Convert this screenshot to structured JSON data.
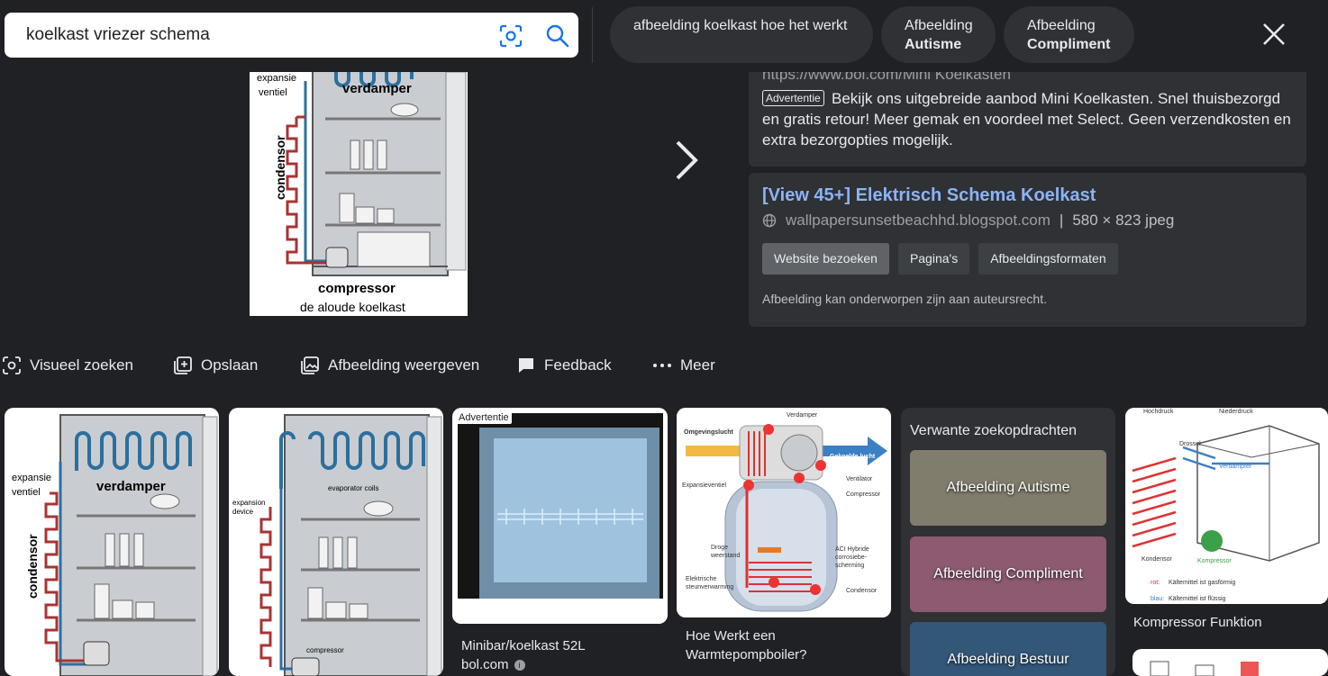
{
  "search": {
    "query": "koelkast vriezer schema"
  },
  "chips": [
    {
      "line1": "afbeelding koelkast hoe het werkt",
      "line2": ""
    },
    {
      "line1": "Afbeelding",
      "line2": "Autisme"
    },
    {
      "line1": "Afbeelding",
      "line2": "Compliment"
    }
  ],
  "preview": {
    "labels": {
      "expansie": "expansie",
      "ventiel": "ventiel",
      "verdamper": "verdamper",
      "condensor": "condensor",
      "compressor": "compressor",
      "caption": "de aloude koelkast"
    }
  },
  "ad": {
    "url": "https://www.bol.com/Mini Koelkasten",
    "badge": "Advertentie",
    "text": "Bekijk ons uitgebreide aanbod Mini Koelkasten. Snel thuisbezorgd en gratis retour! Meer gemak en voordeel met Select. Geen verzendkosten en extra bezorgopties mogelijk."
  },
  "info": {
    "title": "[View 45+] Elektrisch Schema Koelkast",
    "site": "wallpapersunsetbeachhd.blogspot.com",
    "separator": "|",
    "size": "580 × 823 jpeg",
    "buttons": [
      "Website bezoeken",
      "Pagina's",
      "Afbeeldingsformaten"
    ],
    "copyright": "Afbeelding kan onderworpen zijn aan auteursrecht."
  },
  "actions": [
    "Visueel zoeken",
    "Opslaan",
    "Afbeelding weergeven",
    "Feedback",
    "Meer"
  ],
  "results": {
    "card1": {
      "expansie": "expansie",
      "ventiel": "ventiel",
      "verdamper": "verdamper",
      "condensor": "condensor"
    },
    "card2": {
      "evap": "evaporator coils",
      "exp1": "expansion",
      "exp2": "device",
      "comp": "compressor"
    },
    "card3": {
      "badge": "Advertentie",
      "title": "Minibar/koelkast 52L",
      "source": "bol.com"
    },
    "card4": {
      "caption": "Hoe Werkt een Warmtepompboiler?",
      "labels": {
        "verdamper": "Verdamper",
        "omgevingslucht": "Omgevingslucht",
        "gekoelde": "Gekoelde lucht",
        "ventilator": "Ventilator",
        "expansieventiel": "Expansieventiel",
        "compressor": "Compressor",
        "droge1": "Droge",
        "droge2": "weerstand",
        "aci1": "ACI Hybride",
        "aci2": "corrosiebe-",
        "aci3": "scherming",
        "elek1": "Elektrische",
        "elek2": "steunverwarming",
        "condensor": "Condensor"
      }
    },
    "related": {
      "title": "Verwante zoekopdrachten",
      "items": [
        "Afbeelding Autisme",
        "Afbeelding Compliment",
        "Afbeelding Bestuur"
      ]
    },
    "card6": {
      "caption": "Kompressor Funktion",
      "labels": {
        "hochdruck": "Hochdruck",
        "niederdruck": "Niederdruck",
        "drossel": "Drossel",
        "verdampfer": "Verdampfer",
        "kondensor": "Kondensor",
        "kompressor": "Kompressor",
        "rot1": "rot:",
        "rot2": "Kältemittel ist gasförmig",
        "blau1": "blau:",
        "blau2": "Kältemittel ist flüssig"
      }
    }
  }
}
